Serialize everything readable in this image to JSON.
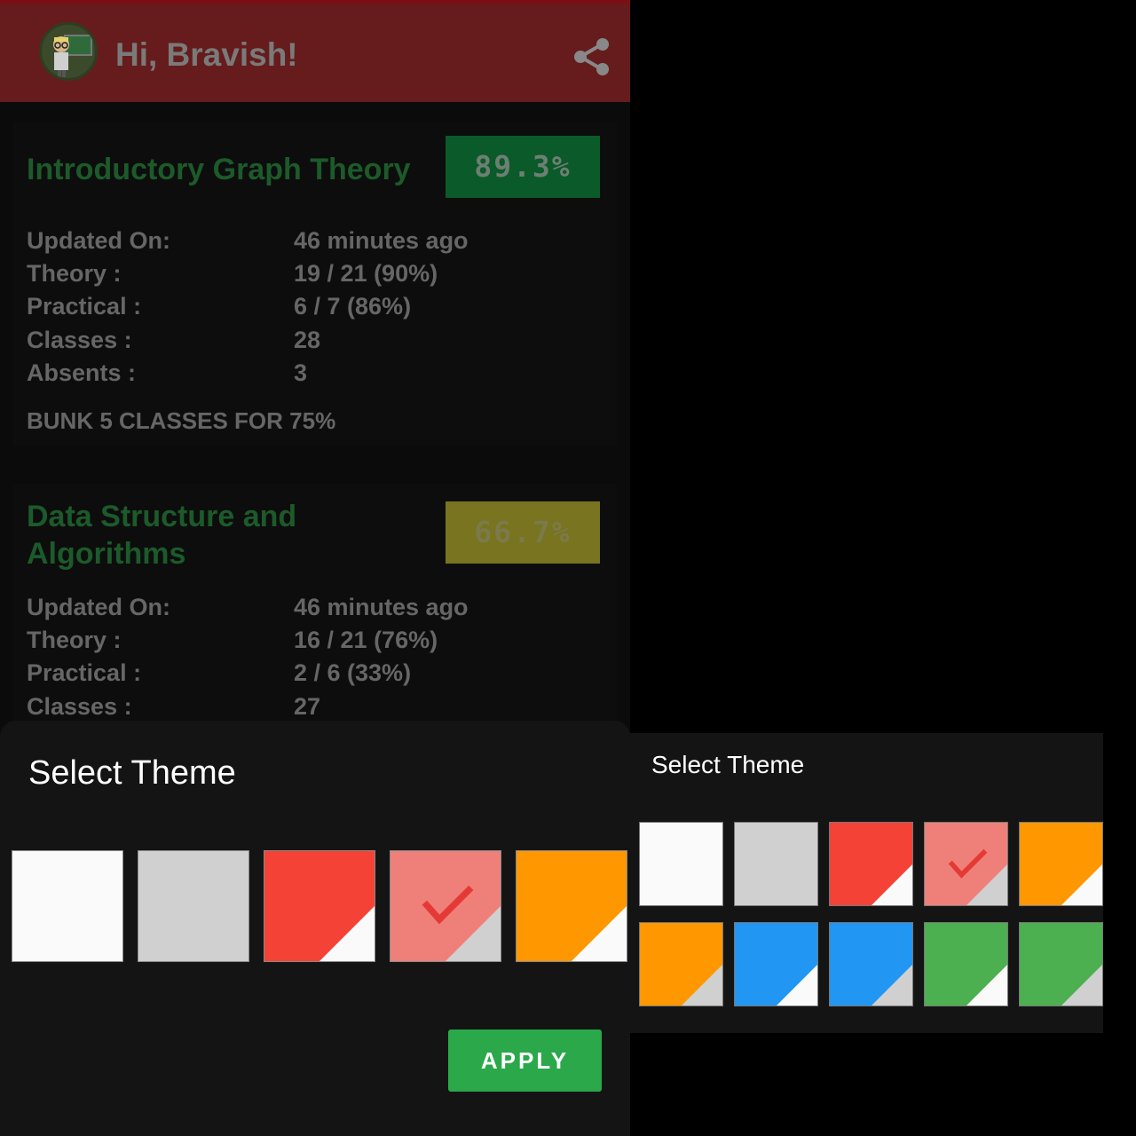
{
  "header": {
    "greeting": "Hi, Bravish!",
    "avatar_icon": "teacher-avatar-icon",
    "share_icon": "share-icon",
    "background": "#661c1c"
  },
  "subjects": [
    {
      "title": "Introductory Graph Theory",
      "percentage": "89.3%",
      "badge_color": "#0b5a2a",
      "badge_text_color": "#6d7f72",
      "rows": [
        {
          "label": "Updated On:",
          "value": "46 minutes ago"
        },
        {
          "label": "Theory :",
          "value": "19 / 21 (90%)"
        },
        {
          "label": "Practical :",
          "value": "6 / 7 (86%)"
        },
        {
          "label": "Classes :",
          "value": "28"
        },
        {
          "label": "Absents :",
          "value": "3"
        }
      ],
      "bunk_note": "BUNK 5 CLASSES FOR 75%"
    },
    {
      "title": "Data Structure and Algorithms",
      "percentage": "66.7%",
      "badge_color": "#78741f",
      "badge_text_color": "#7c7a4a",
      "rows": [
        {
          "label": "Updated On:",
          "value": "46 minutes ago"
        },
        {
          "label": "Theory :",
          "value": "16 / 21 (76%)"
        },
        {
          "label": "Practical :",
          "value": "2 / 6 (33%)"
        },
        {
          "label": "Classes :",
          "value": "27"
        }
      ]
    }
  ],
  "theme_sheet": {
    "title": "Select Theme",
    "apply_label": "APPLY",
    "swatches": [
      {
        "color": "#fafafa",
        "fold": null,
        "selected": false
      },
      {
        "color": "#d0d0d0",
        "fold": null,
        "selected": false
      },
      {
        "color": "#f44336",
        "fold": "#fafafa",
        "selected": false
      },
      {
        "color": "#ef8079",
        "fold": "#d0d0d0",
        "selected": true
      },
      {
        "color": "#ff9800",
        "fold": "#fafafa",
        "selected": false
      }
    ]
  },
  "theme_dialog": {
    "title": "Select Theme",
    "swatches": [
      {
        "color": "#fafafa",
        "fold": null,
        "selected": false
      },
      {
        "color": "#d0d0d0",
        "fold": null,
        "selected": false
      },
      {
        "color": "#f44336",
        "fold": "#fafafa",
        "selected": false
      },
      {
        "color": "#ef8079",
        "fold": "#d0d0d0",
        "selected": true
      },
      {
        "color": "#ff9800",
        "fold": "#fafafa",
        "selected": false
      },
      {
        "color": "#ff9800",
        "fold": "#d0d0d0",
        "selected": false
      },
      {
        "color": "#2196f3",
        "fold": "#fafafa",
        "selected": false
      },
      {
        "color": "#2196f3",
        "fold": "#d0d0d0",
        "selected": false
      },
      {
        "color": "#4caf50",
        "fold": "#fafafa",
        "selected": false
      },
      {
        "color": "#4caf50",
        "fold": "#d0d0d0",
        "selected": false
      }
    ]
  },
  "accent_check_color": "#e53935"
}
